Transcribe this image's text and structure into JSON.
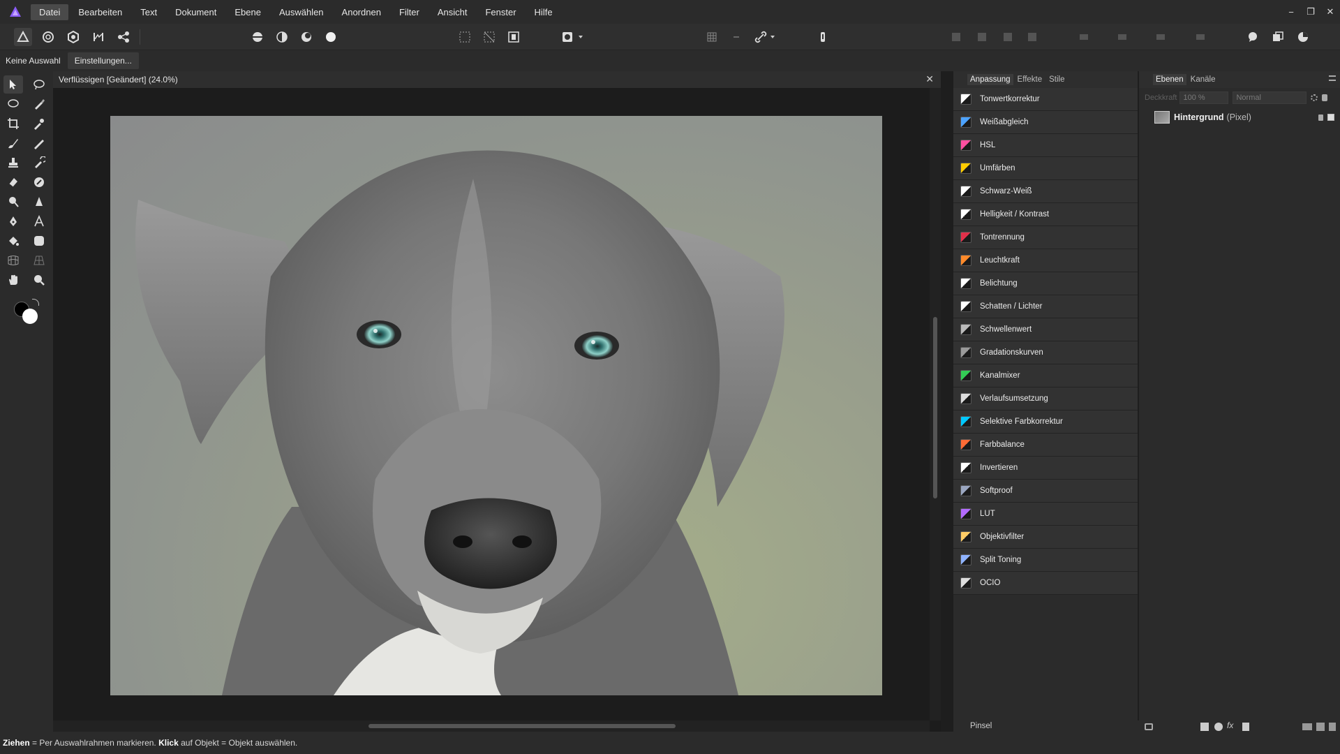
{
  "menu": {
    "items": [
      "Datei",
      "Bearbeiten",
      "Text",
      "Dokument",
      "Ebene",
      "Auswählen",
      "Anordnen",
      "Filter",
      "Ansicht",
      "Fenster",
      "Hilfe"
    ],
    "active": "Datei"
  },
  "window_controls": {
    "minimize": "−",
    "restore": "❐",
    "close": "✕"
  },
  "context": {
    "selection_label": "Keine Auswahl",
    "settings_button": "Einstellungen..."
  },
  "document": {
    "title": "Verflüssigen [Geändert] (24.0%)",
    "close": "✕",
    "zoom_percent": 24.0
  },
  "adjustment_panel": {
    "tabs": [
      "Anpassung",
      "Effekte",
      "Stile"
    ],
    "active_tab": "Anpassung",
    "items": [
      {
        "label": "Tonwertkorrektur",
        "icon": "levels-icon",
        "color": "#ffffff"
      },
      {
        "label": "Weißabgleich",
        "icon": "white-balance-icon",
        "color": "#4da3ff"
      },
      {
        "label": "HSL",
        "icon": "hsl-icon",
        "color": "#ff4fa0"
      },
      {
        "label": "Umfärben",
        "icon": "recolor-icon",
        "color": "#ffcc00"
      },
      {
        "label": "Schwarz-Weiß",
        "icon": "black-white-icon",
        "color": "#ffffff"
      },
      {
        "label": "Helligkeit / Kontrast",
        "icon": "brightness-contrast-icon",
        "color": "#ffffff"
      },
      {
        "label": "Tontrennung",
        "icon": "posterize-icon",
        "color": "#e0304a"
      },
      {
        "label": "Leuchtkraft",
        "icon": "vibrance-icon",
        "color": "#ff8a2a"
      },
      {
        "label": "Belichtung",
        "icon": "exposure-icon",
        "color": "#ffffff"
      },
      {
        "label": "Schatten / Lichter",
        "icon": "shadows-highlights-icon",
        "color": "#ffffff"
      },
      {
        "label": "Schwellenwert",
        "icon": "threshold-icon",
        "color": "#bbbbbb"
      },
      {
        "label": "Gradationskurven",
        "icon": "curves-icon",
        "color": "#9a9a9a"
      },
      {
        "label": "Kanalmixer",
        "icon": "channel-mixer-icon",
        "color": "#33cc55"
      },
      {
        "label": "Verlaufsumsetzung",
        "icon": "gradient-map-icon",
        "color": "#dddddd"
      },
      {
        "label": "Selektive Farbkorrektur",
        "icon": "selective-color-icon",
        "color": "#00c8ff"
      },
      {
        "label": "Farbbalance",
        "icon": "color-balance-icon",
        "color": "#ff6b35"
      },
      {
        "label": "Invertieren",
        "icon": "invert-icon",
        "color": "#ffffff"
      },
      {
        "label": "Softproof",
        "icon": "soft-proof-icon",
        "color": "#9aa6c0"
      },
      {
        "label": "LUT",
        "icon": "lut-icon",
        "color": "#b36bff"
      },
      {
        "label": "Objektivfilter",
        "icon": "lens-filter-icon",
        "color": "#ffcc66"
      },
      {
        "label": "Split Toning",
        "icon": "split-toning-icon",
        "color": "#8fb3ff"
      },
      {
        "label": "OCIO",
        "icon": "ocio-icon",
        "color": "#dddddd"
      }
    ]
  },
  "layers_panel": {
    "tabs": [
      "Ebenen",
      "Kanäle"
    ],
    "active_tab": "Ebenen",
    "opacity_label": "Deckkraft",
    "opacity": "100 %",
    "blend_mode": "Normal",
    "layer": {
      "name": "Hintergrund",
      "type": "(Pixel)"
    }
  },
  "bottom_panel": {
    "brush_label": "Pinsel"
  },
  "status": {
    "drag_key": "Ziehen",
    "drag_text": " = Per Auswahlrahmen markieren. ",
    "click_key": "Klick",
    "click_text": " auf Objekt = Objekt auswählen."
  },
  "colors": {
    "app_bg": "#1e1e1e",
    "panel_bg": "#2b2b2b",
    "accent_logo": "#8a5cf6"
  }
}
